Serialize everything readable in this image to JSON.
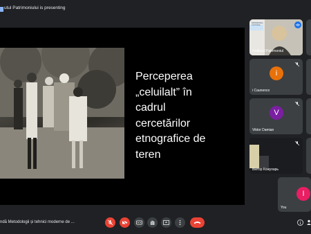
{
  "header": {
    "presenting_text": "utul Patrimoniului is presenting"
  },
  "slide": {
    "lines": [
      "Perceperea",
      "„celuilalt” în",
      "cadrul",
      "cercetărilor",
      "etnografice de",
      "teren"
    ]
  },
  "participants": [
    {
      "name": "Institutul Patrimoniul",
      "badge": "PATRIMONIUL CULTURAL"
    },
    {
      "name": "i Caunenco",
      "initial": "i",
      "color": "#e8710a"
    },
    {
      "name": "Viktor Damian",
      "initial": "V",
      "color": "#7b1fa2"
    },
    {
      "name": "Віктор Кожухарь"
    },
    {
      "name": "You",
      "initial": "I",
      "color": "#e91e63"
    }
  ],
  "footer": {
    "meeting_name": "ndă Metodologii și tehnici moderne de ..."
  },
  "colors": {
    "background": "#202124",
    "tile": "#3c4043",
    "danger": "#ea4335",
    "accent": "#8ab4f8"
  }
}
